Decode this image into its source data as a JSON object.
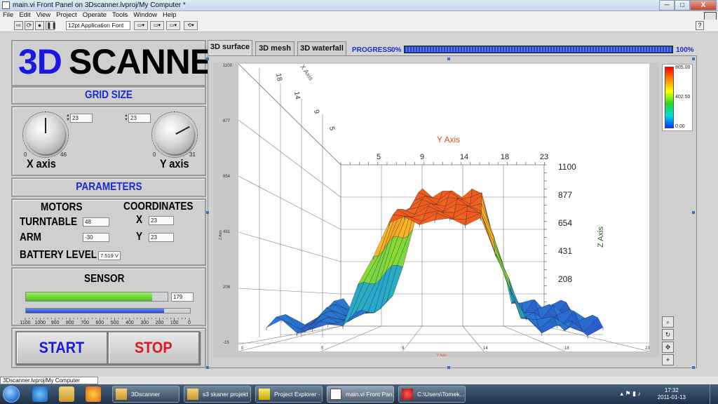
{
  "window": {
    "title": "main.vi Front Panel on 3Dscanner.lvproj/My Computer *",
    "minimize": "─",
    "maximize": "□",
    "close": "X"
  },
  "menu": [
    "File",
    "Edit",
    "View",
    "Project",
    "Operate",
    "Tools",
    "Window",
    "Help"
  ],
  "toolbar": {
    "font": "12pt Application Font",
    "run_icon": "run-arrow-icon",
    "help": "?"
  },
  "logo": {
    "part1": "3D",
    "part2": "SCANNER"
  },
  "grid_size": {
    "header": "GRID SIZE",
    "x": {
      "value": "23",
      "min": "0",
      "max": "46",
      "label": "X axis"
    },
    "y": {
      "value": "23",
      "min": "0",
      "max": "31",
      "label": "Y axis"
    }
  },
  "parameters": {
    "header": "PARAMETERS",
    "motors_label": "MOTORS",
    "coordinates_label": "COORDINATES",
    "turntable_label": "TURNTABLE",
    "turntable_value": "48",
    "arm_label": "ARM",
    "arm_value": "-30",
    "x_label": "X",
    "x_value": "23",
    "y_label": "Y",
    "y_value": "23",
    "battery_label": "BATTERY LEVEL",
    "battery_value": "7.519 V"
  },
  "sensor": {
    "header": "SENSOR",
    "value": "179",
    "level_fraction": 0.89,
    "slider_fraction": 0.84,
    "scale": [
      "1100",
      "1000",
      "900",
      "800",
      "700",
      "600",
      "500",
      "400",
      "300",
      "200",
      "100",
      "0"
    ]
  },
  "buttons": {
    "start": "START",
    "stop": "STOP"
  },
  "tabs": [
    "3D surface",
    "3D mesh",
    "3D waterfall"
  ],
  "progress": {
    "label": "PROGRESS",
    "min": "0%",
    "max": "100%",
    "fraction": 1.0
  },
  "plot": {
    "y_axis_title": "Y Axis",
    "z_axis_title": "Z Axis",
    "y_ticks": [
      "5",
      "9",
      "14",
      "18",
      "23"
    ],
    "z_ticks": [
      "1100",
      "877",
      "654",
      "431",
      "208"
    ],
    "x_back_ticks": [
      "18",
      "14",
      "9",
      "5"
    ],
    "left_z_ticks": [
      "1100",
      "877",
      "654",
      "431",
      "208",
      "-15"
    ],
    "bottom_ticks": [
      "0",
      "5",
      "9",
      "14",
      "18",
      "23"
    ],
    "bottom_title": "Y Axis",
    "left_title": "Z Axis",
    "x_axis_title_back": "X Axis",
    "colorbar": [
      "805.00",
      "402.50",
      "0.00"
    ]
  },
  "status": {
    "path": "3Dscanner.lvproj/My Computer"
  },
  "taskbar": {
    "tasks": [
      "3Dscanner",
      "s3 skaner projekt",
      "Project Explorer - ...",
      "main.vi Front Pan...",
      "C:\\Users\\Tomek..."
    ],
    "time": "17:32",
    "date": "2011-01-13"
  }
}
